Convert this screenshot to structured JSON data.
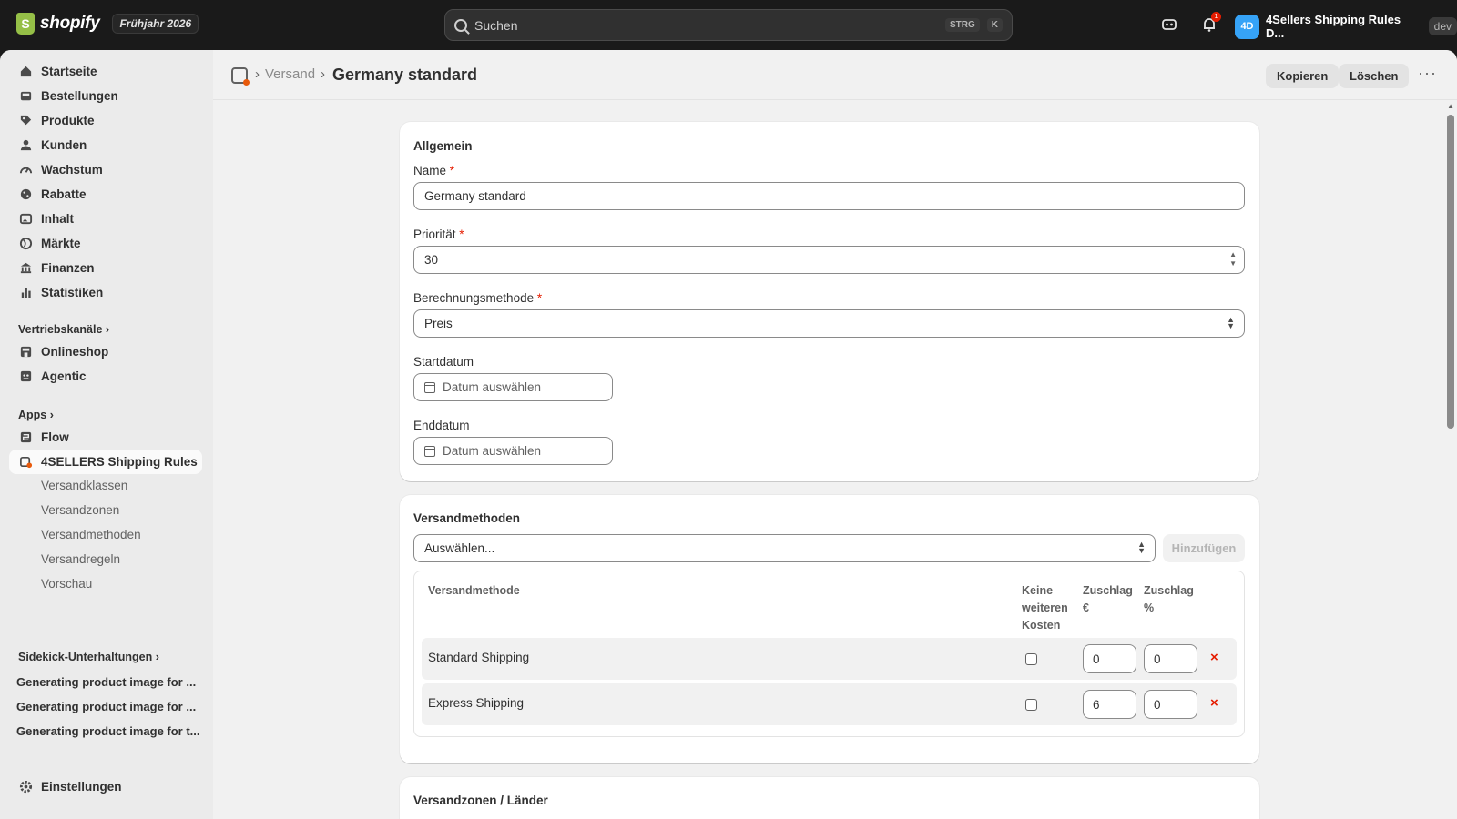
{
  "topbar": {
    "brand": "shopify",
    "season": "Frühjahr 2026",
    "search_placeholder": "Suchen",
    "shortcut_1": "STRG",
    "shortcut_2": "K",
    "notification_count": "1",
    "store_initials": "4D",
    "store_name": "4Sellers Shipping Rules D...",
    "env_badge": "dev"
  },
  "sidebar": {
    "main_items": [
      {
        "label": "Startseite",
        "icon": "home-icon"
      },
      {
        "label": "Bestellungen",
        "icon": "inbox-icon"
      },
      {
        "label": "Produkte",
        "icon": "tag-icon"
      },
      {
        "label": "Kunden",
        "icon": "person-icon"
      },
      {
        "label": "Wachstum",
        "icon": "gauge-icon"
      },
      {
        "label": "Rabatte",
        "icon": "discount-icon"
      },
      {
        "label": "Inhalt",
        "icon": "image-icon"
      },
      {
        "label": "Märkte",
        "icon": "globe-icon"
      },
      {
        "label": "Finanzen",
        "icon": "bank-icon"
      },
      {
        "label": "Statistiken",
        "icon": "bar-chart-icon"
      }
    ],
    "sales_channels_title": "Vertriebskanäle",
    "sales_channels": [
      {
        "label": "Onlineshop",
        "icon": "store-icon"
      },
      {
        "label": "Agentic",
        "icon": "agent-icon"
      }
    ],
    "apps_title": "Apps",
    "apps": [
      {
        "label": "Flow",
        "icon": "flow-icon"
      },
      {
        "label": "4SELLERS Shipping Rules",
        "icon": "shipping-app-icon"
      }
    ],
    "app_sub_items": [
      "Versandklassen",
      "Versandzonen",
      "Versandmethoden",
      "Versandregeln",
      "Vorschau"
    ],
    "sidekick_title": "Sidekick-Unterhaltungen",
    "sidekick_items": [
      "Generating product image for ...",
      "Generating product image for ...",
      "Generating product image for t..."
    ],
    "settings_label": "Einstellungen"
  },
  "header": {
    "breadcrumb_parent": "Versand",
    "title": "Germany standard",
    "copy_label": "Kopieren",
    "delete_label": "Löschen",
    "more_label": "···"
  },
  "general": {
    "title": "Allgemein",
    "name_label": "Name",
    "name_value": "Germany standard",
    "priority_label": "Priorität",
    "priority_value": "30",
    "method_label": "Berechnungsmethode",
    "method_value": "Preis",
    "start_label": "Startdatum",
    "start_placeholder": "Datum auswählen",
    "end_label": "Enddatum",
    "end_placeholder": "Datum auswählen",
    "required_mark": "*"
  },
  "shipping_methods": {
    "title": "Versandmethoden",
    "select_placeholder": "Auswählen...",
    "add_label": "Hinzufügen",
    "columns": {
      "method": "Versandmethode",
      "no_costs_1": "Keine",
      "no_costs_2": "weiteren",
      "no_costs_3": "Kosten",
      "surcharge_eur_1": "Zuschlag",
      "surcharge_eur_2": "€",
      "surcharge_pct_1": "Zuschlag",
      "surcharge_pct_2": "%"
    },
    "rows": [
      {
        "name": "Standard Shipping",
        "eur": "0",
        "pct": "0"
      },
      {
        "name": "Express Shipping",
        "eur": "6",
        "pct": "0"
      }
    ],
    "remove_symbol": "×"
  },
  "zones": {
    "title": "Versandzonen / Länder"
  }
}
